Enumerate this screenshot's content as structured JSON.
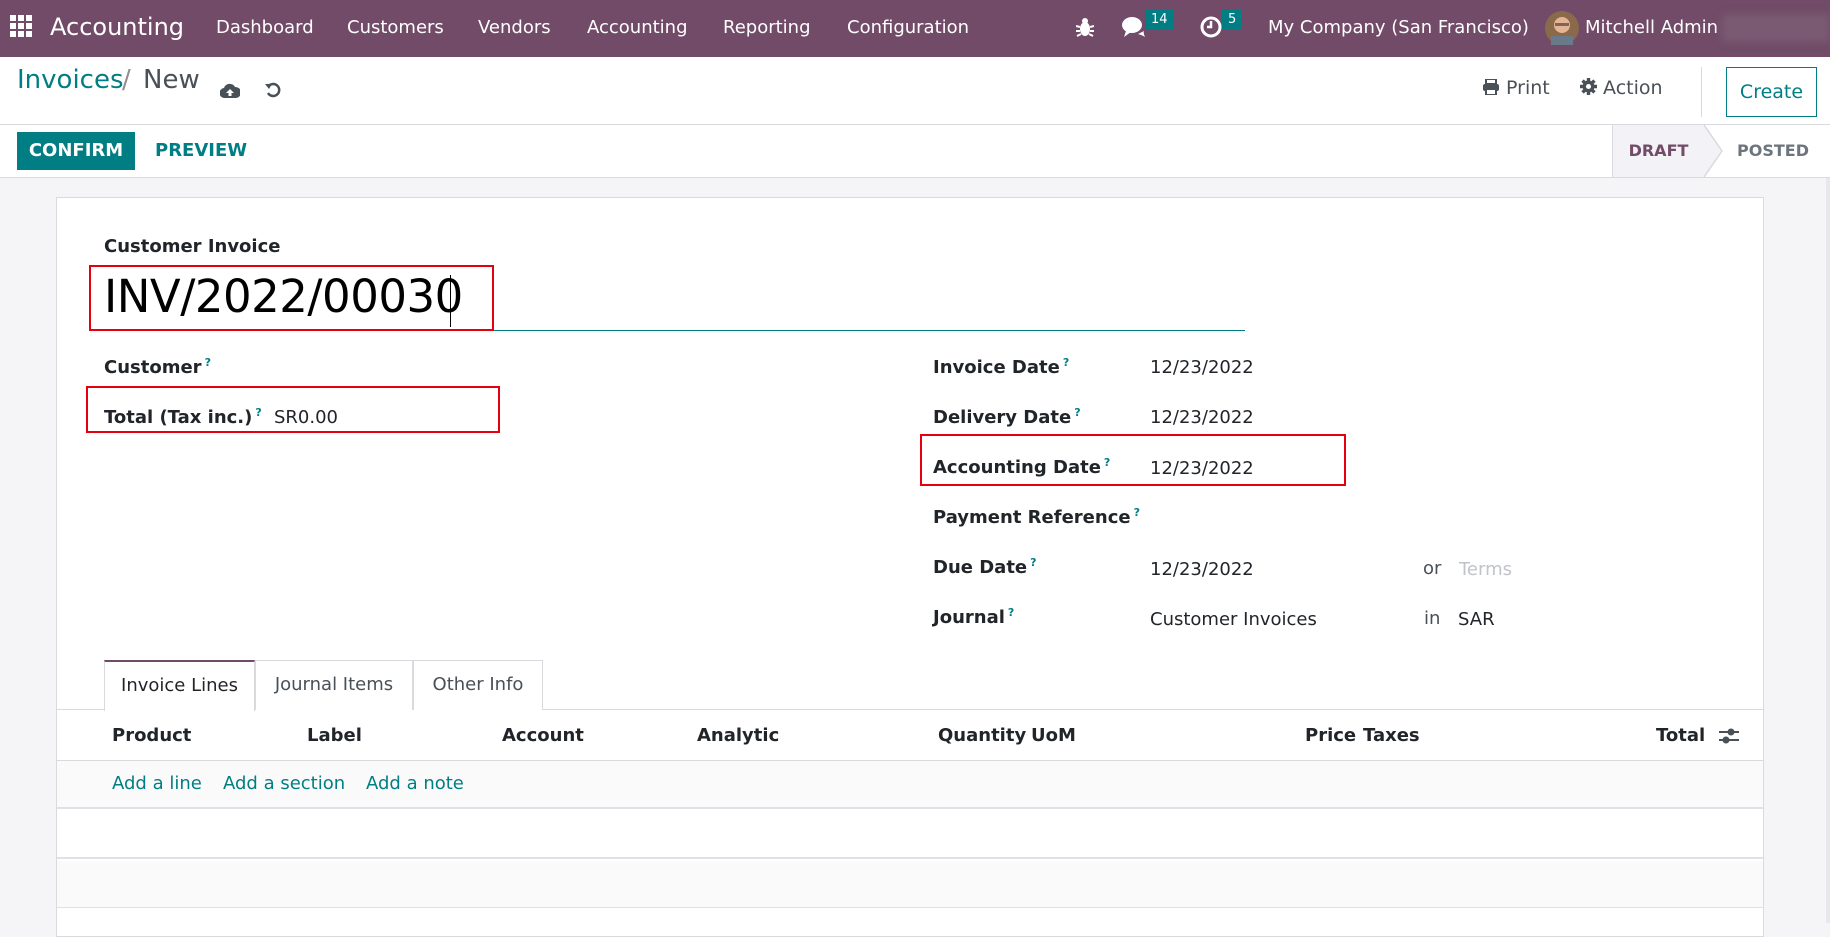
{
  "navbar": {
    "app_name": "Accounting",
    "menu": [
      "Dashboard",
      "Customers",
      "Vendors",
      "Accounting",
      "Reporting",
      "Configuration"
    ],
    "messages_count": "14",
    "activities_count": "5",
    "company": "My Company (San Francisco)",
    "user": "Mitchell Admin",
    "icons": {
      "apps": "grid-icon",
      "debug": "bug-icon",
      "messages": "chat-icon",
      "activities": "clock-icon"
    }
  },
  "control_panel": {
    "breadcrumb_parent": "Invoices",
    "breadcrumb_sep": "/",
    "breadcrumb_current": "New",
    "print_label": "Print",
    "action_label": "Action",
    "create_label": "Create"
  },
  "statusbar": {
    "confirm_label": "CONFIRM",
    "preview_label": "PREVIEW",
    "stages": [
      "DRAFT",
      "POSTED"
    ],
    "active_stage": "DRAFT"
  },
  "form": {
    "title_label": "Customer Invoice",
    "invoice_number": "INV/2022/00030",
    "customer_label": "Customer",
    "total_label": "Total (Tax inc.)",
    "total_value": "SR0.00",
    "help_mark": "?",
    "invoice_date_label": "Invoice Date",
    "invoice_date": "12/23/2022",
    "delivery_date_label": "Delivery Date",
    "delivery_date": "12/23/2022",
    "accounting_date_label": "Accounting Date",
    "accounting_date": "12/23/2022",
    "payment_reference_label": "Payment Reference",
    "due_date_label": "Due Date",
    "due_date": "12/23/2022",
    "or_label": "or",
    "terms_placeholder": "Terms",
    "journal_label": "Journal",
    "journal_value": "Customer Invoices",
    "in_label": "in",
    "currency": "SAR"
  },
  "tabs": [
    "Invoice Lines",
    "Journal Items",
    "Other Info"
  ],
  "lines_table": {
    "columns": [
      "Product",
      "Label",
      "Account",
      "Analytic",
      "Quantity",
      "UoM",
      "Price",
      "Taxes",
      "Total"
    ],
    "add_links": [
      "Add a line",
      "Add a section",
      "Add a note"
    ]
  }
}
